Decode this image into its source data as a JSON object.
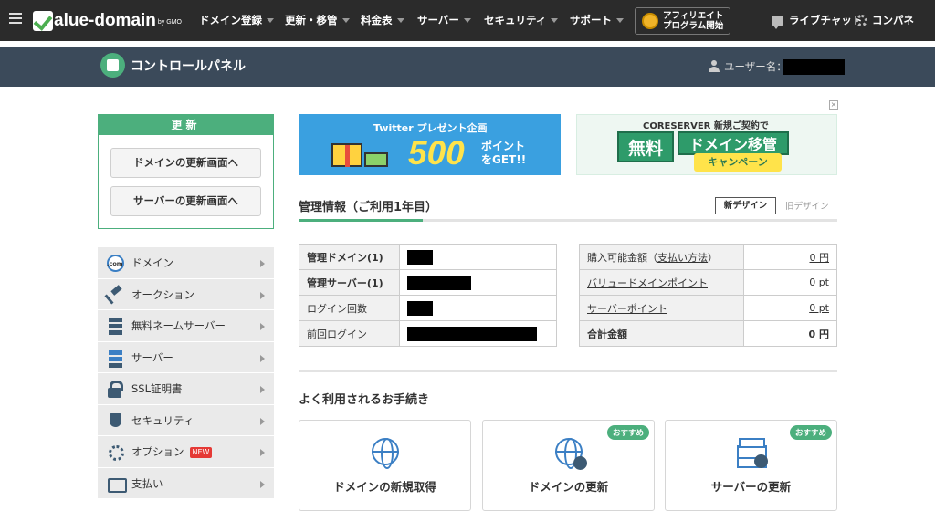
{
  "topnav": {
    "logo_text": "alue-domain",
    "logo_gmo": "by GMO",
    "items": [
      {
        "label": "ドメイン登録"
      },
      {
        "label": "更新・移管"
      },
      {
        "label": "料金表"
      },
      {
        "label": "サーバー"
      },
      {
        "label": "セキュリティ"
      },
      {
        "label": "サポート"
      }
    ],
    "affiliate_line1": "アフィリエイト",
    "affiliate_line2": "プログラム開始",
    "live_chat": "ライブチャット",
    "control_panel": "コンパネ"
  },
  "subheader": {
    "title": "コントロールパネル",
    "user_label": "ユーザー名："
  },
  "renew": {
    "heading": "更新",
    "domain_button": "ドメインの更新画面へ",
    "server_button": "サーバーの更新画面へ"
  },
  "side_menu": [
    {
      "label": "ドメイン",
      "icon": "domain-com-icon"
    },
    {
      "label": "オークション",
      "icon": "auction-hammer-icon"
    },
    {
      "label": "無料ネームサーバー",
      "icon": "nameserver-icon"
    },
    {
      "label": "サーバー",
      "icon": "server-icon"
    },
    {
      "label": "SSL証明書",
      "icon": "ssl-lock-icon"
    },
    {
      "label": "セキュリティ",
      "icon": "shield-icon"
    },
    {
      "label": "オプション",
      "icon": "gear-icon",
      "badge": "NEW"
    },
    {
      "label": "支払い",
      "icon": "credit-card-icon"
    }
  ],
  "banners": {
    "twitter_title": "Twitter プレゼント企画",
    "twitter_big": "500",
    "twitter_point_line1": "ポイント",
    "twitter_point_line2": "をGET!!",
    "core_title": "CORESERVER 新規ご契約で",
    "core_free": "無料",
    "core_domain": "ドメイン移管",
    "core_campaign": "キャンペーン",
    "ad_close": "×"
  },
  "management": {
    "title": "管理情報（ご利用1年目）",
    "new_design": "新デザイン",
    "old_design": "旧デザイン",
    "left_rows": [
      {
        "key": "管理ドメイン(1)",
        "bold": true
      },
      {
        "key": "管理サーバー(1)",
        "bold": true
      },
      {
        "key": "ログイン回数",
        "bold": false
      },
      {
        "key": "前回ログイン",
        "bold": false
      }
    ],
    "right_rows": [
      {
        "key": "購入可能金額（支払い方法）",
        "value": "0 円"
      },
      {
        "key": "バリュードメインポイント",
        "value": "0 pt"
      },
      {
        "key": "サーバーポイント",
        "value": "0 pt"
      },
      {
        "key": "合計金額",
        "value": "0 円"
      }
    ],
    "pay_method_link": "支払い方法"
  },
  "frequent": {
    "title": "よく利用されるお手続き",
    "cards": [
      {
        "title": "ドメインの新規取得",
        "badge": ""
      },
      {
        "title": "ドメインの更新",
        "badge": "おすすめ"
      },
      {
        "title": "サーバーの更新",
        "badge": "おすすめ"
      }
    ]
  }
}
